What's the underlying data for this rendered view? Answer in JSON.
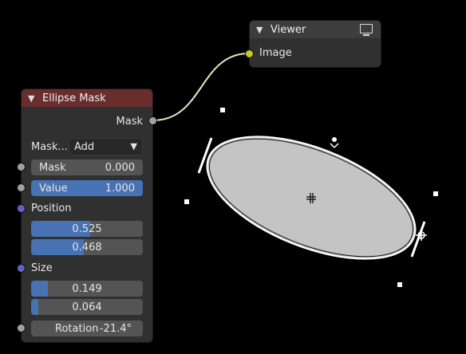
{
  "viewer_node": {
    "title": "Viewer",
    "input_label": "Image"
  },
  "ellipse_node": {
    "title": "Ellipse Mask",
    "output_label": "Mask",
    "mask_type_label": "Mask...",
    "mask_type_value": "Add",
    "mask": {
      "label": "Mask",
      "value": "0.000"
    },
    "value": {
      "label": "Value",
      "value": "1.000"
    },
    "position": {
      "label": "Position",
      "x": "0.525",
      "y": "0.468",
      "x_fill": 0.525,
      "y_fill": 0.468
    },
    "size": {
      "label": "Size",
      "width": "0.149",
      "height": "0.064",
      "width_fill": 0.149,
      "height_fill": 0.064
    },
    "rotation": {
      "label": "Rotation",
      "value": "-21.4°"
    }
  },
  "colors": {
    "node_bg": "#303030",
    "header_red": "#6a2d2d",
    "field_blue": "#4772b3",
    "socket_yellow": "#c7c729",
    "socket_purple": "#6363c7",
    "ellipse_fill": "#c4c4c4"
  }
}
